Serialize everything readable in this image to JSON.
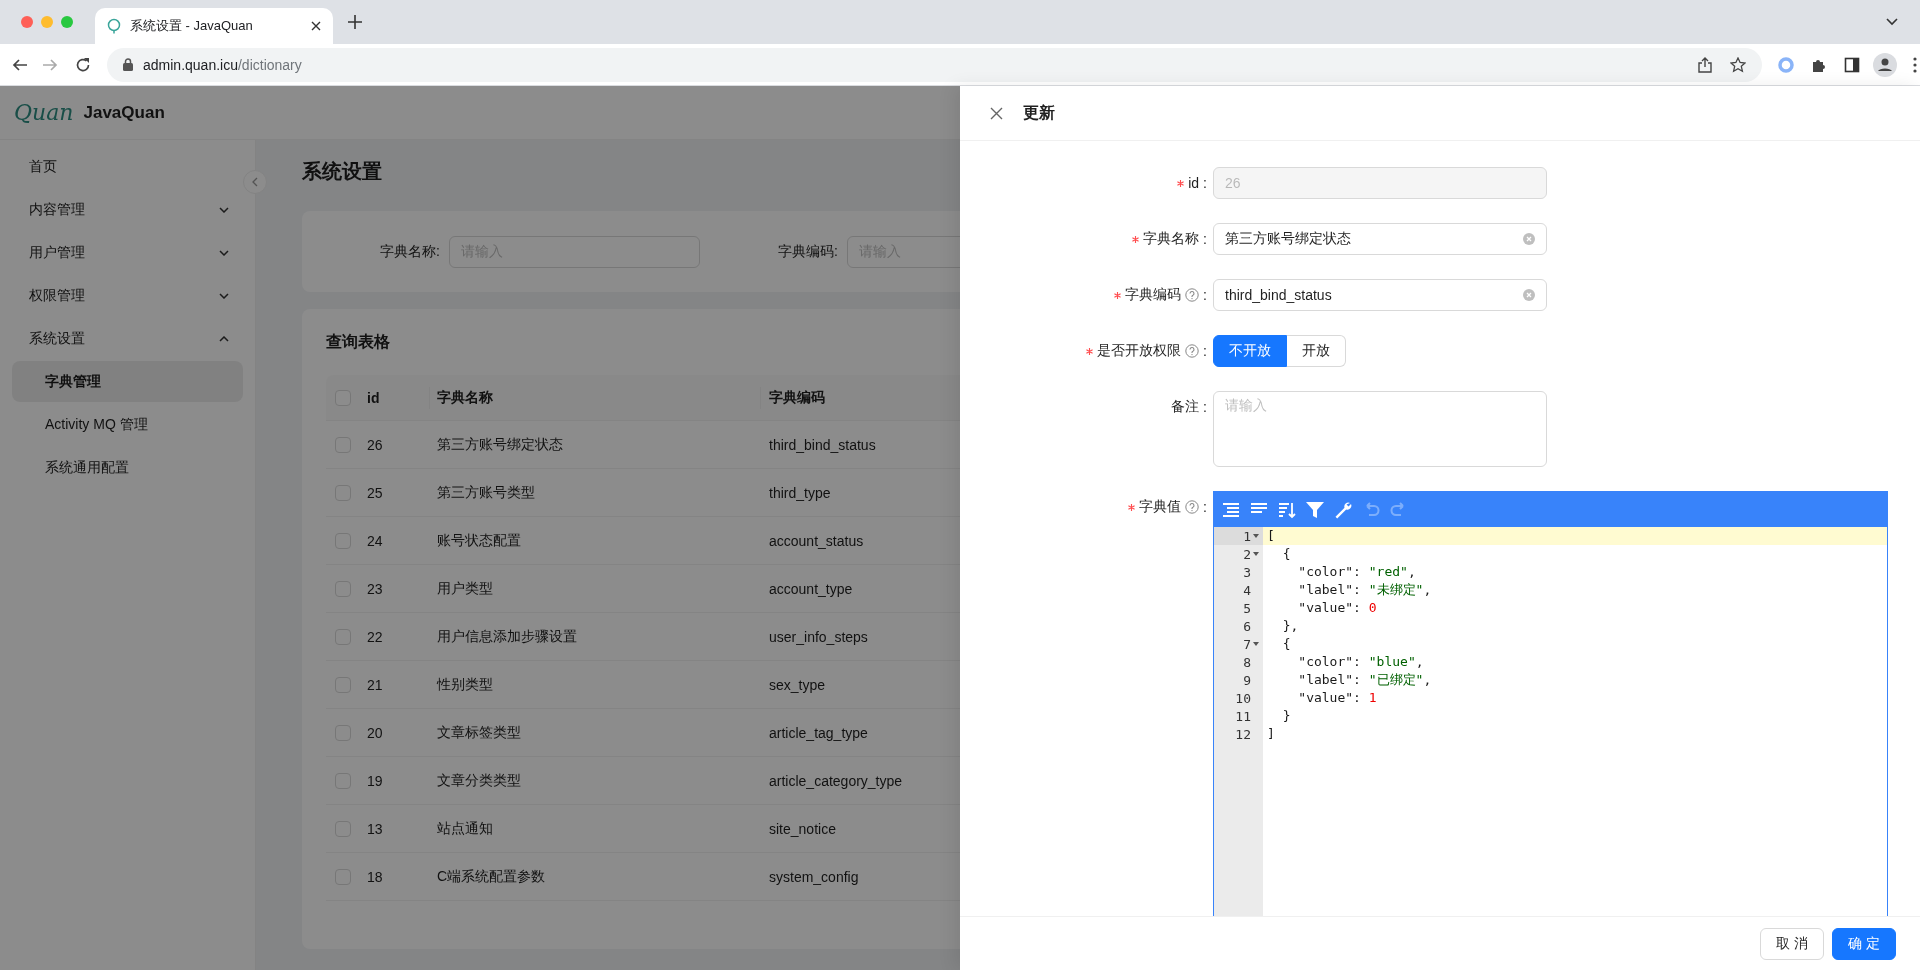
{
  "browser": {
    "tab_title": "系统设置 - JavaQuan",
    "url_host": "admin.quan.icu",
    "url_path": "/dictionary"
  },
  "app": {
    "logo_script": "Quan",
    "name": "JavaQuan"
  },
  "sidebar": {
    "items": [
      {
        "label": "首页",
        "selected": false
      },
      {
        "label": "内容管理",
        "selected": false,
        "expanded": false
      },
      {
        "label": "用户管理",
        "selected": false,
        "expanded": false
      },
      {
        "label": "权限管理",
        "selected": false,
        "expanded": false
      },
      {
        "label": "系统设置",
        "selected": false,
        "expanded": true,
        "children": [
          {
            "label": "字典管理",
            "selected": true
          },
          {
            "label": "Activity MQ 管理",
            "selected": false
          },
          {
            "label": "系统通用配置",
            "selected": false
          }
        ]
      }
    ]
  },
  "page": {
    "title": "系统设置"
  },
  "search": {
    "fields": [
      {
        "label": "字典名称:",
        "placeholder": "请输入"
      },
      {
        "label": "字典编码:",
        "placeholder": "请输入"
      }
    ]
  },
  "table": {
    "title": "查询表格",
    "header_checked": false,
    "columns": [
      "id",
      "字典名称",
      "字典编码"
    ],
    "rows": [
      {
        "checked": false,
        "cells": [
          "26",
          "第三方账号绑定状态",
          "third_bind_status"
        ]
      },
      {
        "checked": false,
        "cells": [
          "25",
          "第三方账号类型",
          "third_type"
        ]
      },
      {
        "checked": false,
        "cells": [
          "24",
          "账号状态配置",
          "account_status"
        ]
      },
      {
        "checked": false,
        "cells": [
          "23",
          "用户类型",
          "account_type"
        ]
      },
      {
        "checked": false,
        "cells": [
          "22",
          "用户信息添加步骤设置",
          "user_info_steps"
        ]
      },
      {
        "checked": false,
        "cells": [
          "21",
          "性别类型",
          "sex_type"
        ]
      },
      {
        "checked": false,
        "cells": [
          "20",
          "文章标签类型",
          "article_tag_type"
        ]
      },
      {
        "checked": false,
        "cells": [
          "19",
          "文章分类类型",
          "article_category_type"
        ]
      },
      {
        "checked": false,
        "cells": [
          "13",
          "站点通知",
          "site_notice"
        ]
      },
      {
        "checked": false,
        "cells": [
          "18",
          "C端系统配置参数",
          "system_config"
        ]
      }
    ]
  },
  "drawer": {
    "title": "更新",
    "fields": [
      {
        "kind": "input",
        "label": "id",
        "colon": ":",
        "required": true,
        "help": false,
        "value": "26",
        "disabled": true,
        "clearable": false
      },
      {
        "kind": "input",
        "label": "字典名称",
        "colon": ":",
        "required": true,
        "help": false,
        "value": "第三方账号绑定状态",
        "disabled": false,
        "clearable": true
      },
      {
        "kind": "input",
        "label": "字典编码",
        "colon": ":",
        "required": true,
        "help": true,
        "value": "third_bind_status",
        "disabled": false,
        "clearable": true
      },
      {
        "kind": "segmented",
        "label": "是否开放权限",
        "colon": ":",
        "required": true,
        "help": true,
        "options": [
          {
            "label": "不开放",
            "selected": true
          },
          {
            "label": "开放",
            "selected": false
          }
        ]
      },
      {
        "kind": "textarea",
        "label": "备注",
        "colon": ":",
        "required": false,
        "help": false,
        "placeholder": "请输入"
      },
      {
        "kind": "json",
        "label": "字典值",
        "colon": ":",
        "required": true,
        "help": true,
        "toolbar": [
          {
            "kind": "format",
            "disabled": false
          },
          {
            "kind": "compact",
            "disabled": false
          },
          {
            "kind": "sort",
            "disabled": false
          },
          {
            "kind": "filter",
            "disabled": false
          },
          {
            "kind": "transform",
            "disabled": false
          },
          {
            "kind": "undo",
            "disabled": true
          },
          {
            "kind": "redo",
            "disabled": true
          }
        ],
        "lines": [
          {
            "number": "1",
            "text": "[",
            "fold": true,
            "active": true
          },
          {
            "number": "2",
            "text": "  {",
            "fold": true,
            "active": false
          },
          {
            "number": "3",
            "text": "    \"color\": \"red\",",
            "fold": false,
            "active": false
          },
          {
            "number": "4",
            "text": "    \"label\": \"未绑定\",",
            "fold": false,
            "active": false
          },
          {
            "number": "5",
            "text": "    \"value\": 0",
            "fold": false,
            "active": false
          },
          {
            "number": "6",
            "text": "  },",
            "fold": false,
            "active": false
          },
          {
            "number": "7",
            "text": "  {",
            "fold": true,
            "active": false
          },
          {
            "number": "8",
            "text": "    \"color\": \"blue\",",
            "fold": false,
            "active": false
          },
          {
            "number": "9",
            "text": "    \"label\": \"已绑定\",",
            "fold": false,
            "active": false
          },
          {
            "number": "10",
            "text": "    \"value\": 1",
            "fold": false,
            "active": false
          },
          {
            "number": "11",
            "text": "  }",
            "fold": false,
            "active": false
          },
          {
            "number": "12",
            "text": "]",
            "fold": false,
            "active": false
          }
        ]
      }
    ],
    "buttons": [
      {
        "label": "取 消",
        "kind": "default"
      },
      {
        "label": "确 定",
        "kind": "primary"
      }
    ]
  }
}
